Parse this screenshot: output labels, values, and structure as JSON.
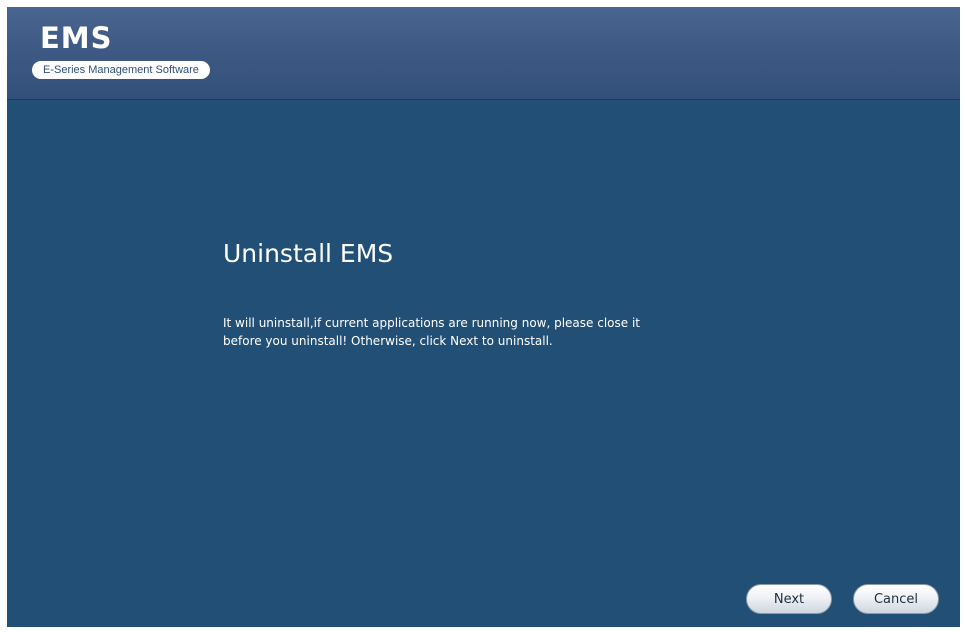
{
  "header": {
    "logo_title": "EMS",
    "logo_subtitle": "E-Series Management Software"
  },
  "main": {
    "title": "Uninstall EMS",
    "message_line1": "It will uninstall,if current applications are running now, please close it",
    "message_line2": "before you uninstall! Otherwise, click Next to uninstall."
  },
  "buttons": {
    "next_label": "Next",
    "cancel_label": "Cancel"
  },
  "colors": {
    "background": "#224f76",
    "header": "#3e5a84",
    "text": "#ffffff"
  }
}
